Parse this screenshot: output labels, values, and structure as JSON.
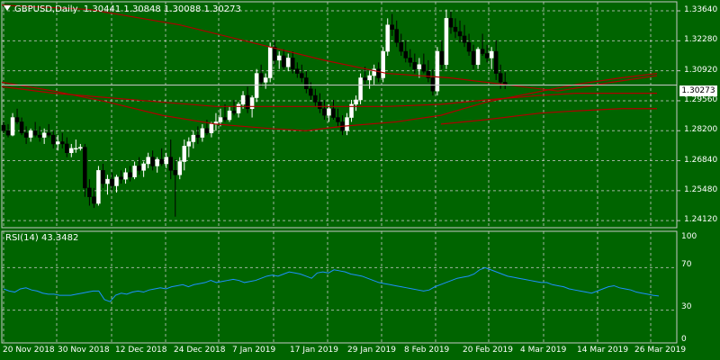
{
  "header": {
    "symbol": "GBPUSD,Daily",
    "open": "1.30441",
    "high": "1.30848",
    "low": "1.30088",
    "close": "1.30273"
  },
  "current_price": "1.30273",
  "price_axis_labels": [
    "1.33640",
    "1.32280",
    "1.30920",
    "1.29560",
    "1.28200",
    "1.26840",
    "1.25480",
    "1.24120"
  ],
  "price_axis_values": [
    1.3364,
    1.3228,
    1.3092,
    1.2956,
    1.282,
    1.2684,
    1.2548,
    1.2412
  ],
  "rsi": {
    "label": "RSI(14) 43.3482",
    "levels": [
      "100",
      "70",
      "30",
      "0"
    ],
    "level_values": [
      100,
      70,
      30,
      0
    ]
  },
  "date_labels": [
    "20 Nov 2018",
    "30 Nov 2018",
    "12 Dec 2018",
    "24 Dec 2018",
    "7 Jan 2019",
    "17 Jan 2019",
    "29 Jan 2019",
    "8 Feb 2019",
    "20 Feb 2019",
    "4 Mar 2019",
    "14 Mar 2019",
    "26 Mar 2019"
  ],
  "colors": {
    "background": "#006400",
    "bull": "#ffffff",
    "bear": "#000000",
    "grid": "#c8c8c8",
    "ma": "#b00000",
    "rsi_line": "#1e90ff"
  },
  "icons": {
    "menu": "triangle-down-icon"
  }
}
